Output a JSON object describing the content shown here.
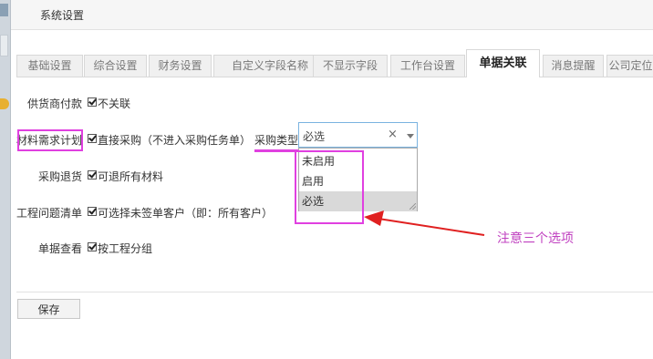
{
  "window": {
    "title": "系统设置"
  },
  "tabs": [
    {
      "label": "基础设置"
    },
    {
      "label": "综合设置"
    },
    {
      "label": "财务设置"
    },
    {
      "label": "自定义字段名称"
    },
    {
      "label": "不显示字段"
    },
    {
      "label": "工作台设置"
    },
    {
      "label": "单据关联",
      "active": true
    },
    {
      "label": "消息提醒"
    },
    {
      "label": "公司定位"
    }
  ],
  "settings": {
    "supplier_payment": {
      "label": "供货商付款",
      "checked": true,
      "option": "不关联"
    },
    "material_plan": {
      "label": "材料需求计划",
      "checked": true,
      "option": "直接采购（不进入采购任务单）",
      "type_label": "采购类型",
      "select_value": "必选",
      "clear_symbol": "×",
      "options": [
        "未启用",
        "启用",
        "必选"
      ],
      "selected_option": "必选"
    },
    "purchase_return": {
      "label": "采购退货",
      "checked": true,
      "option": "可退所有材料"
    },
    "project_issues": {
      "label": "工程问题清单",
      "checked": true,
      "option": "可选择未签单客户（即：所有客户）"
    },
    "document_view": {
      "label": "单据查看",
      "checked": true,
      "option": "按工程分组"
    }
  },
  "annotation": {
    "text": "注意三个选项",
    "color": "#c040c0"
  },
  "footer": {
    "save_label": "保存"
  },
  "colors": {
    "highlight": "#e040e0",
    "arrow": "#e02020"
  }
}
